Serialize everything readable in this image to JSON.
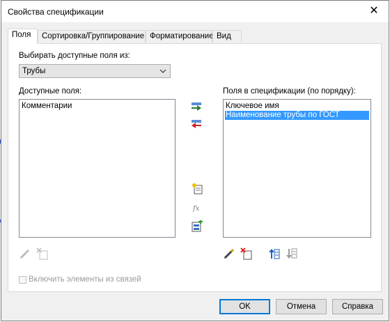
{
  "window": {
    "title": "Свойства спецификации",
    "close_glyph": "✕"
  },
  "tabs": [
    {
      "label": "Поля",
      "active": true
    },
    {
      "label": "Сортировка/Группирование",
      "active": false
    },
    {
      "label": "Форматирование",
      "active": false
    },
    {
      "label": "Вид",
      "active": false
    }
  ],
  "fields_tab": {
    "select_from_label": "Выбирать доступные поля из:",
    "category_dropdown": {
      "value": "Трубы"
    },
    "available_label": "Доступные поля:",
    "available_items": [
      "Комментарии"
    ],
    "scheduled_label": "Поля в спецификации (по порядку):",
    "scheduled_items": [
      {
        "text": "Ключевое имя",
        "selected": false
      },
      {
        "text": "Наименование трубы по ГОСТ",
        "selected": true
      }
    ],
    "include_linked_label": "Включить элементы из связей",
    "include_linked_checked": false
  },
  "buttons": {
    "ok": "OK",
    "cancel": "Отмена",
    "help": "Справка"
  },
  "icons": {
    "add_parameter": "add-right-arrow-icon",
    "remove_parameter": "remove-left-arrow-icon",
    "new_parameter": "new-parameter-icon",
    "calculated_value": "fx-icon",
    "combine_parameters": "combine-parameters-icon",
    "edit": "pencil-icon",
    "delete": "delete-icon",
    "move_up": "move-up-icon",
    "move_down": "move-down-icon"
  },
  "colors": {
    "selection": "#3399ff",
    "default_button_border": "#0078d7",
    "dialog_bg": "#f0f0f0"
  }
}
